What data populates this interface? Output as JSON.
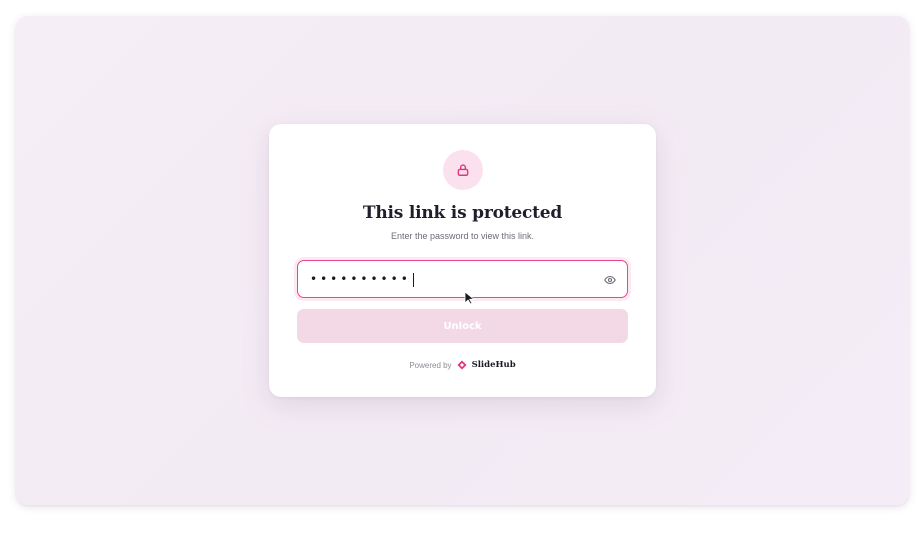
{
  "card": {
    "title": "This link is protected",
    "subtitle": "Enter the password to view this link."
  },
  "password": {
    "masked_value": "••••••••••",
    "show_icon": "eye-icon"
  },
  "unlock_button": {
    "label": "Unlock"
  },
  "footer": {
    "powered_by": "Powered by",
    "brand": "SlideHub"
  },
  "colors": {
    "accent": "#e5468f",
    "button_disabled": "#f3d8e6",
    "lock_bg": "#fbe1ee"
  }
}
